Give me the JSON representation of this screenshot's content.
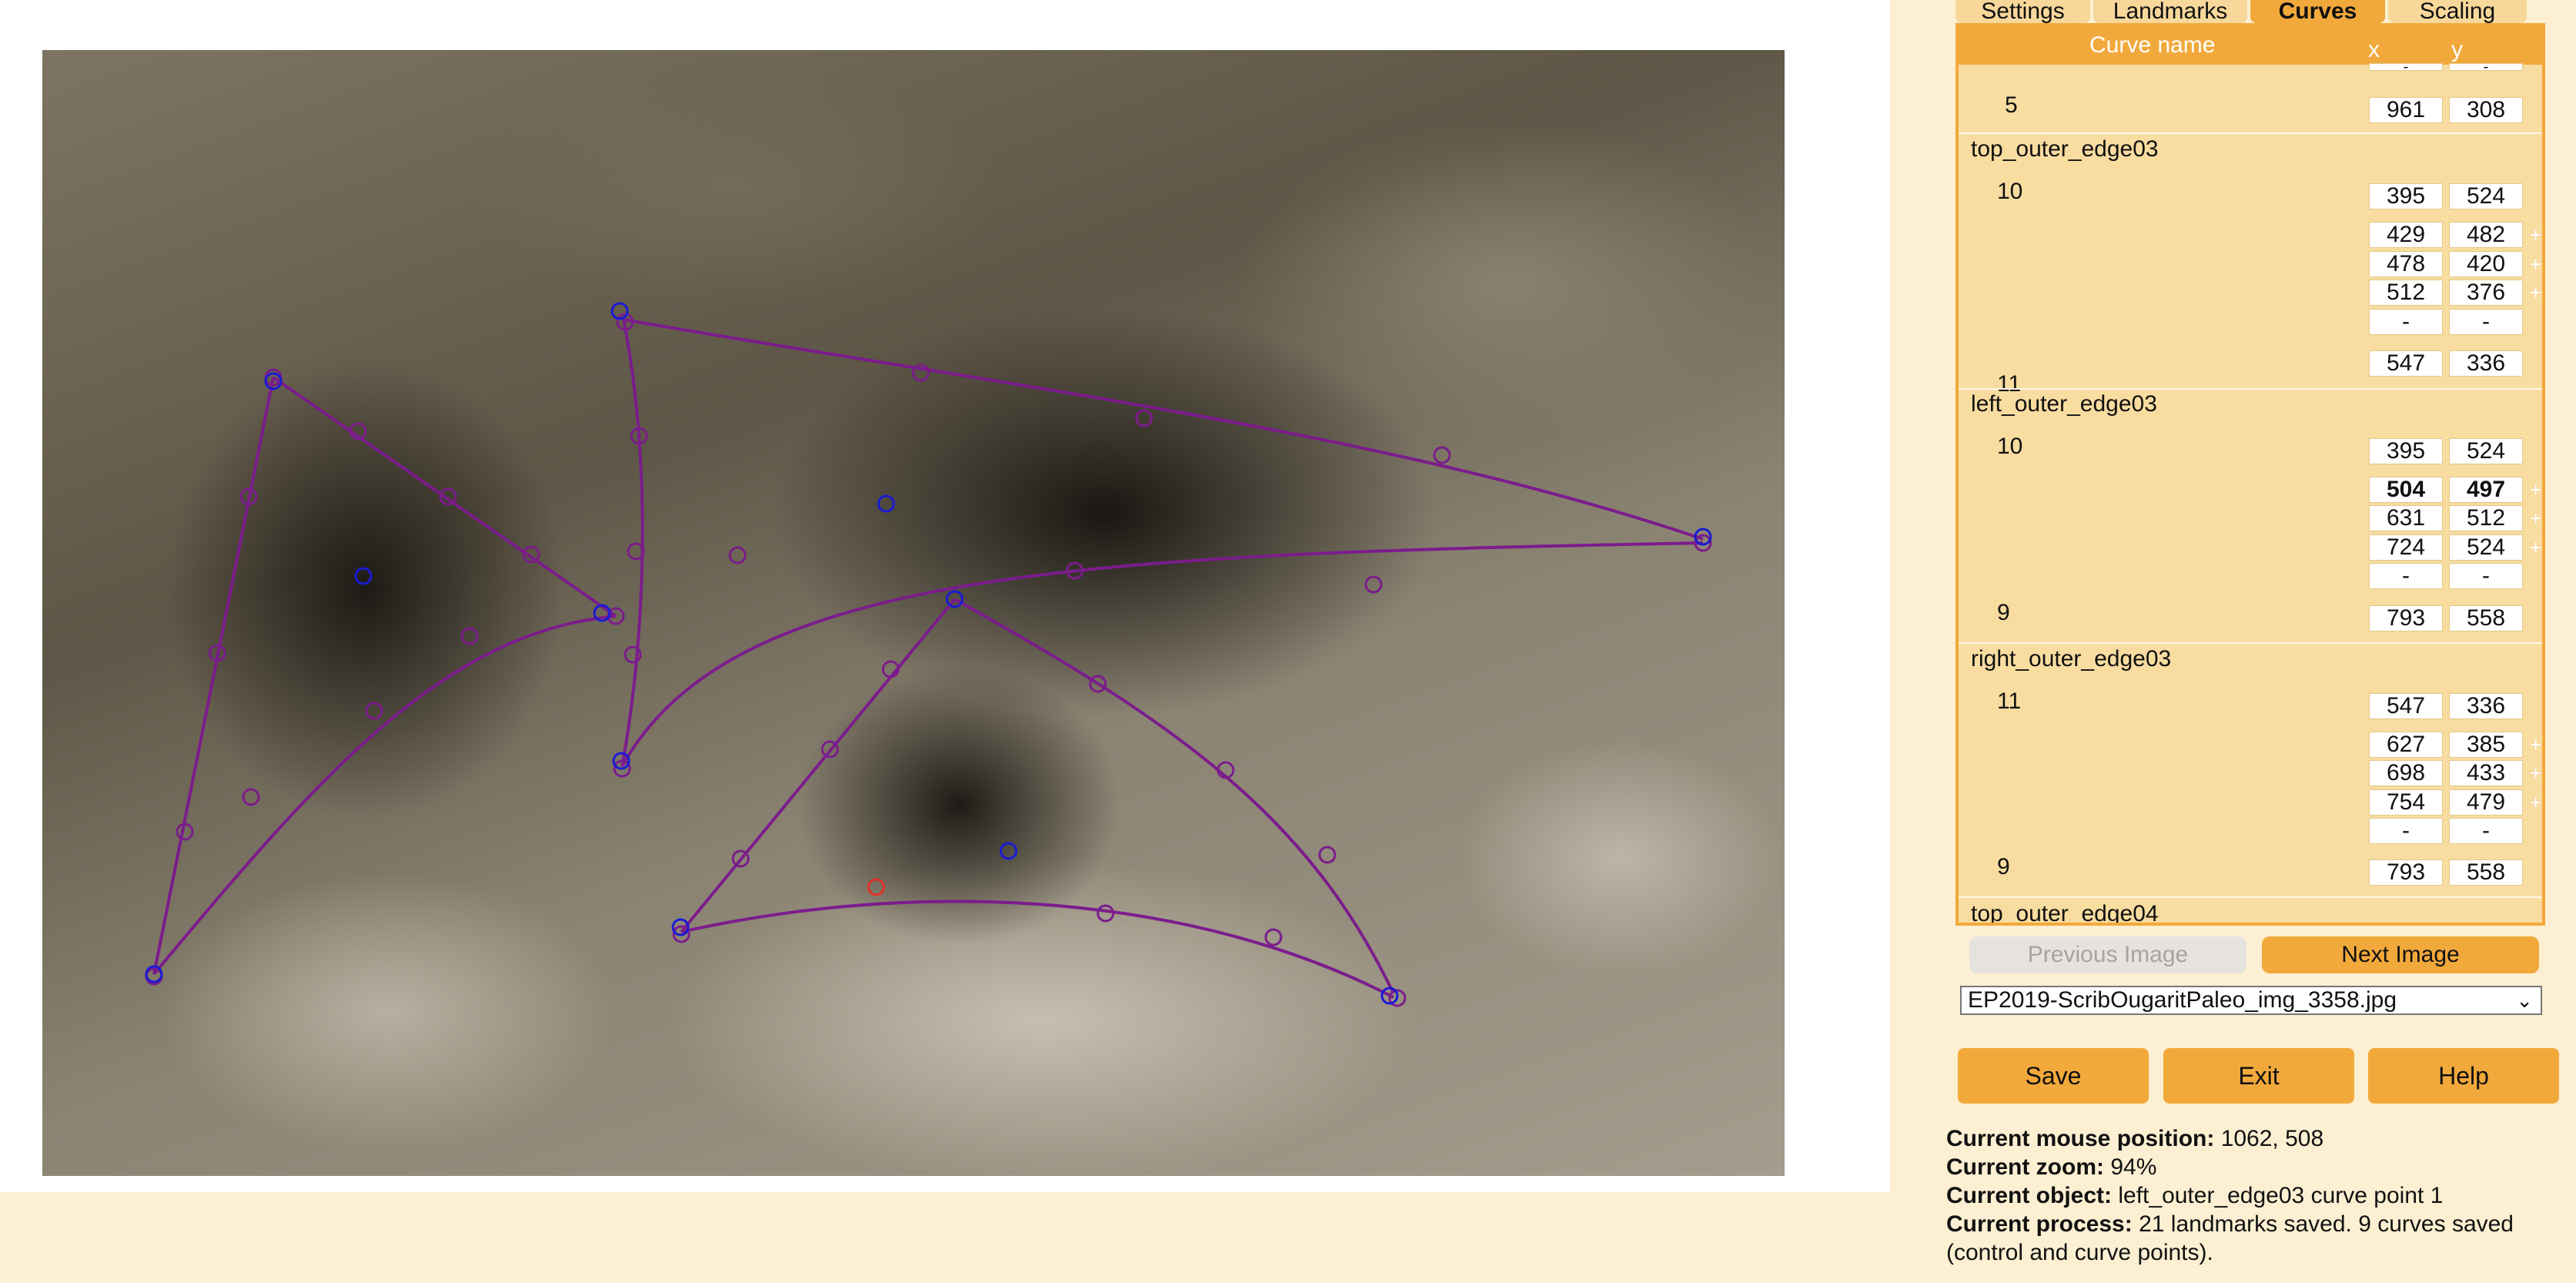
{
  "tabs": [
    "Settings",
    "Landmarks",
    "Curves",
    "Scaling"
  ],
  "active_tab": "Curves",
  "curves_table": {
    "header_name": "Curve name",
    "header_x": "x",
    "header_y": "y",
    "dash": "-",
    "plus": "+",
    "top_partial": {
      "label": "5",
      "x": "961",
      "y": "308"
    },
    "curves": [
      {
        "name": "top_outer_edge03",
        "start": {
          "label": "10",
          "x": "395",
          "y": "524"
        },
        "points": [
          {
            "x": "429",
            "y": "482"
          },
          {
            "x": "478",
            "y": "420"
          },
          {
            "x": "512",
            "y": "376"
          }
        ],
        "end": {
          "label": "11",
          "x": "547",
          "y": "336"
        }
      },
      {
        "name": "left_outer_edge03",
        "start": {
          "label": "10",
          "x": "395",
          "y": "524"
        },
        "points": [
          {
            "x": "504",
            "y": "497"
          },
          {
            "x": "631",
            "y": "512"
          },
          {
            "x": "724",
            "y": "524"
          }
        ],
        "end": {
          "label": "9",
          "x": "793",
          "y": "558"
        }
      },
      {
        "name": "right_outer_edge03",
        "start": {
          "label": "11",
          "x": "547",
          "y": "336"
        },
        "points": [
          {
            "x": "627",
            "y": "385"
          },
          {
            "x": "698",
            "y": "433"
          },
          {
            "x": "754",
            "y": "479"
          }
        ],
        "end": {
          "label": "9",
          "x": "793",
          "y": "558"
        }
      }
    ],
    "next_partial_name": "top_outer_edge04"
  },
  "nav": {
    "previous": "Previous Image",
    "next": "Next Image"
  },
  "image_select": {
    "value": "EP2019-ScribOugaritPaleo_img_3358.jpg"
  },
  "actions": {
    "save": "Save",
    "exit": "Exit",
    "help": "Help"
  },
  "status": {
    "mouse_label": "Current mouse position:",
    "mouse_value": "1062, 508",
    "zoom_label": "Current zoom:",
    "zoom_value": "94%",
    "object_label": "Current object:",
    "object_value": "left_outer_edge03 curve point 1",
    "process_label": "Current process:",
    "process_value": "21 landmarks saved. 9 curves saved (control and curve points)."
  },
  "colors": {
    "accent": "#f2a93b",
    "panel_bg": "#fcefd2",
    "curve": "#7b1c8c",
    "landmark": "#1a1ad6",
    "selected_point": "#e0302a"
  }
}
